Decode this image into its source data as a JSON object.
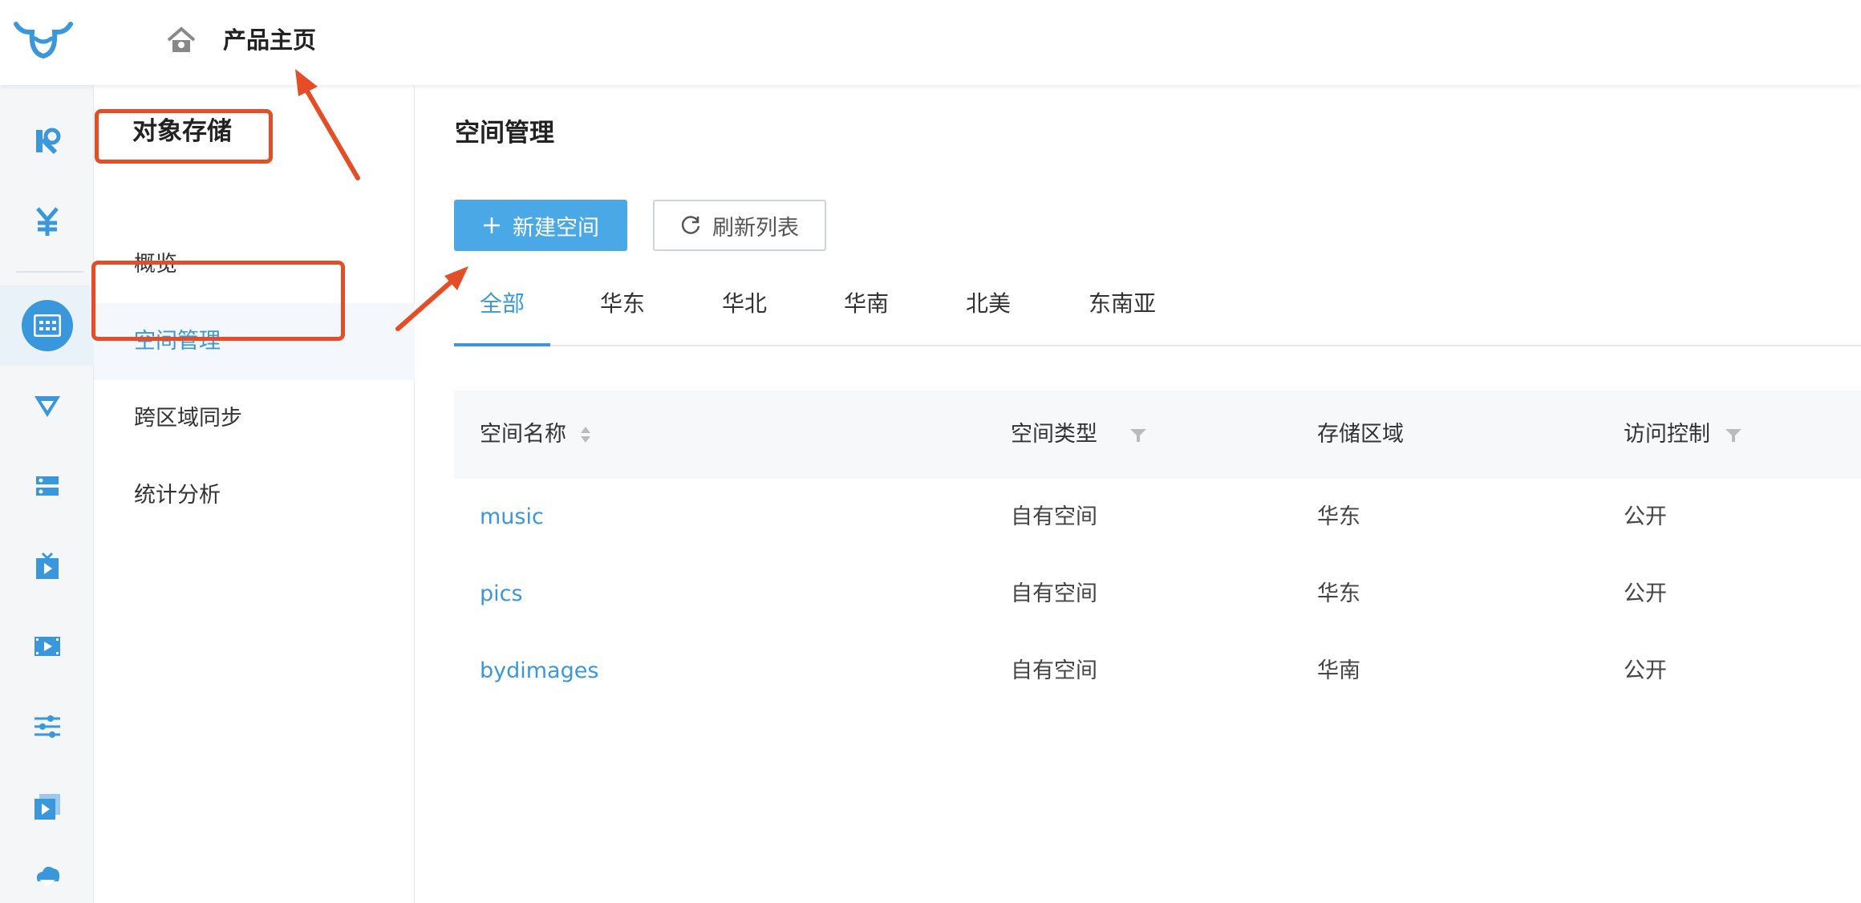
{
  "header": {
    "home_label": "产品主页"
  },
  "rail": {
    "icons": [
      "logo-icon",
      "yen-icon",
      "storage-grid-icon",
      "funnel-icon",
      "server-icon",
      "tv-icon",
      "video-icon",
      "sliders-icon",
      "play-box-icon",
      "cloud-mail-icon"
    ]
  },
  "subnav": {
    "title": "对象存储",
    "items": [
      {
        "label": "概览"
      },
      {
        "label": "空间管理"
      },
      {
        "label": "跨区域同步"
      },
      {
        "label": "统计分析"
      }
    ]
  },
  "main": {
    "title": "空间管理",
    "new_button": "新建空间",
    "refresh_button": "刷新列表",
    "tabs": [
      {
        "label": "全部"
      },
      {
        "label": "华东"
      },
      {
        "label": "华北"
      },
      {
        "label": "华南"
      },
      {
        "label": "北美"
      },
      {
        "label": "东南亚"
      }
    ],
    "table": {
      "columns": [
        "空间名称",
        "空间类型",
        "存储区域",
        "访问控制"
      ],
      "rows": [
        [
          "music",
          "自有空间",
          "华东",
          "公开"
        ],
        [
          "pics",
          "自有空间",
          "华东",
          "公开"
        ],
        [
          "bydimages",
          "自有空间",
          "华南",
          "公开"
        ]
      ]
    }
  },
  "colors": {
    "accent": "#3a97dc",
    "callout": "#e54d26"
  }
}
